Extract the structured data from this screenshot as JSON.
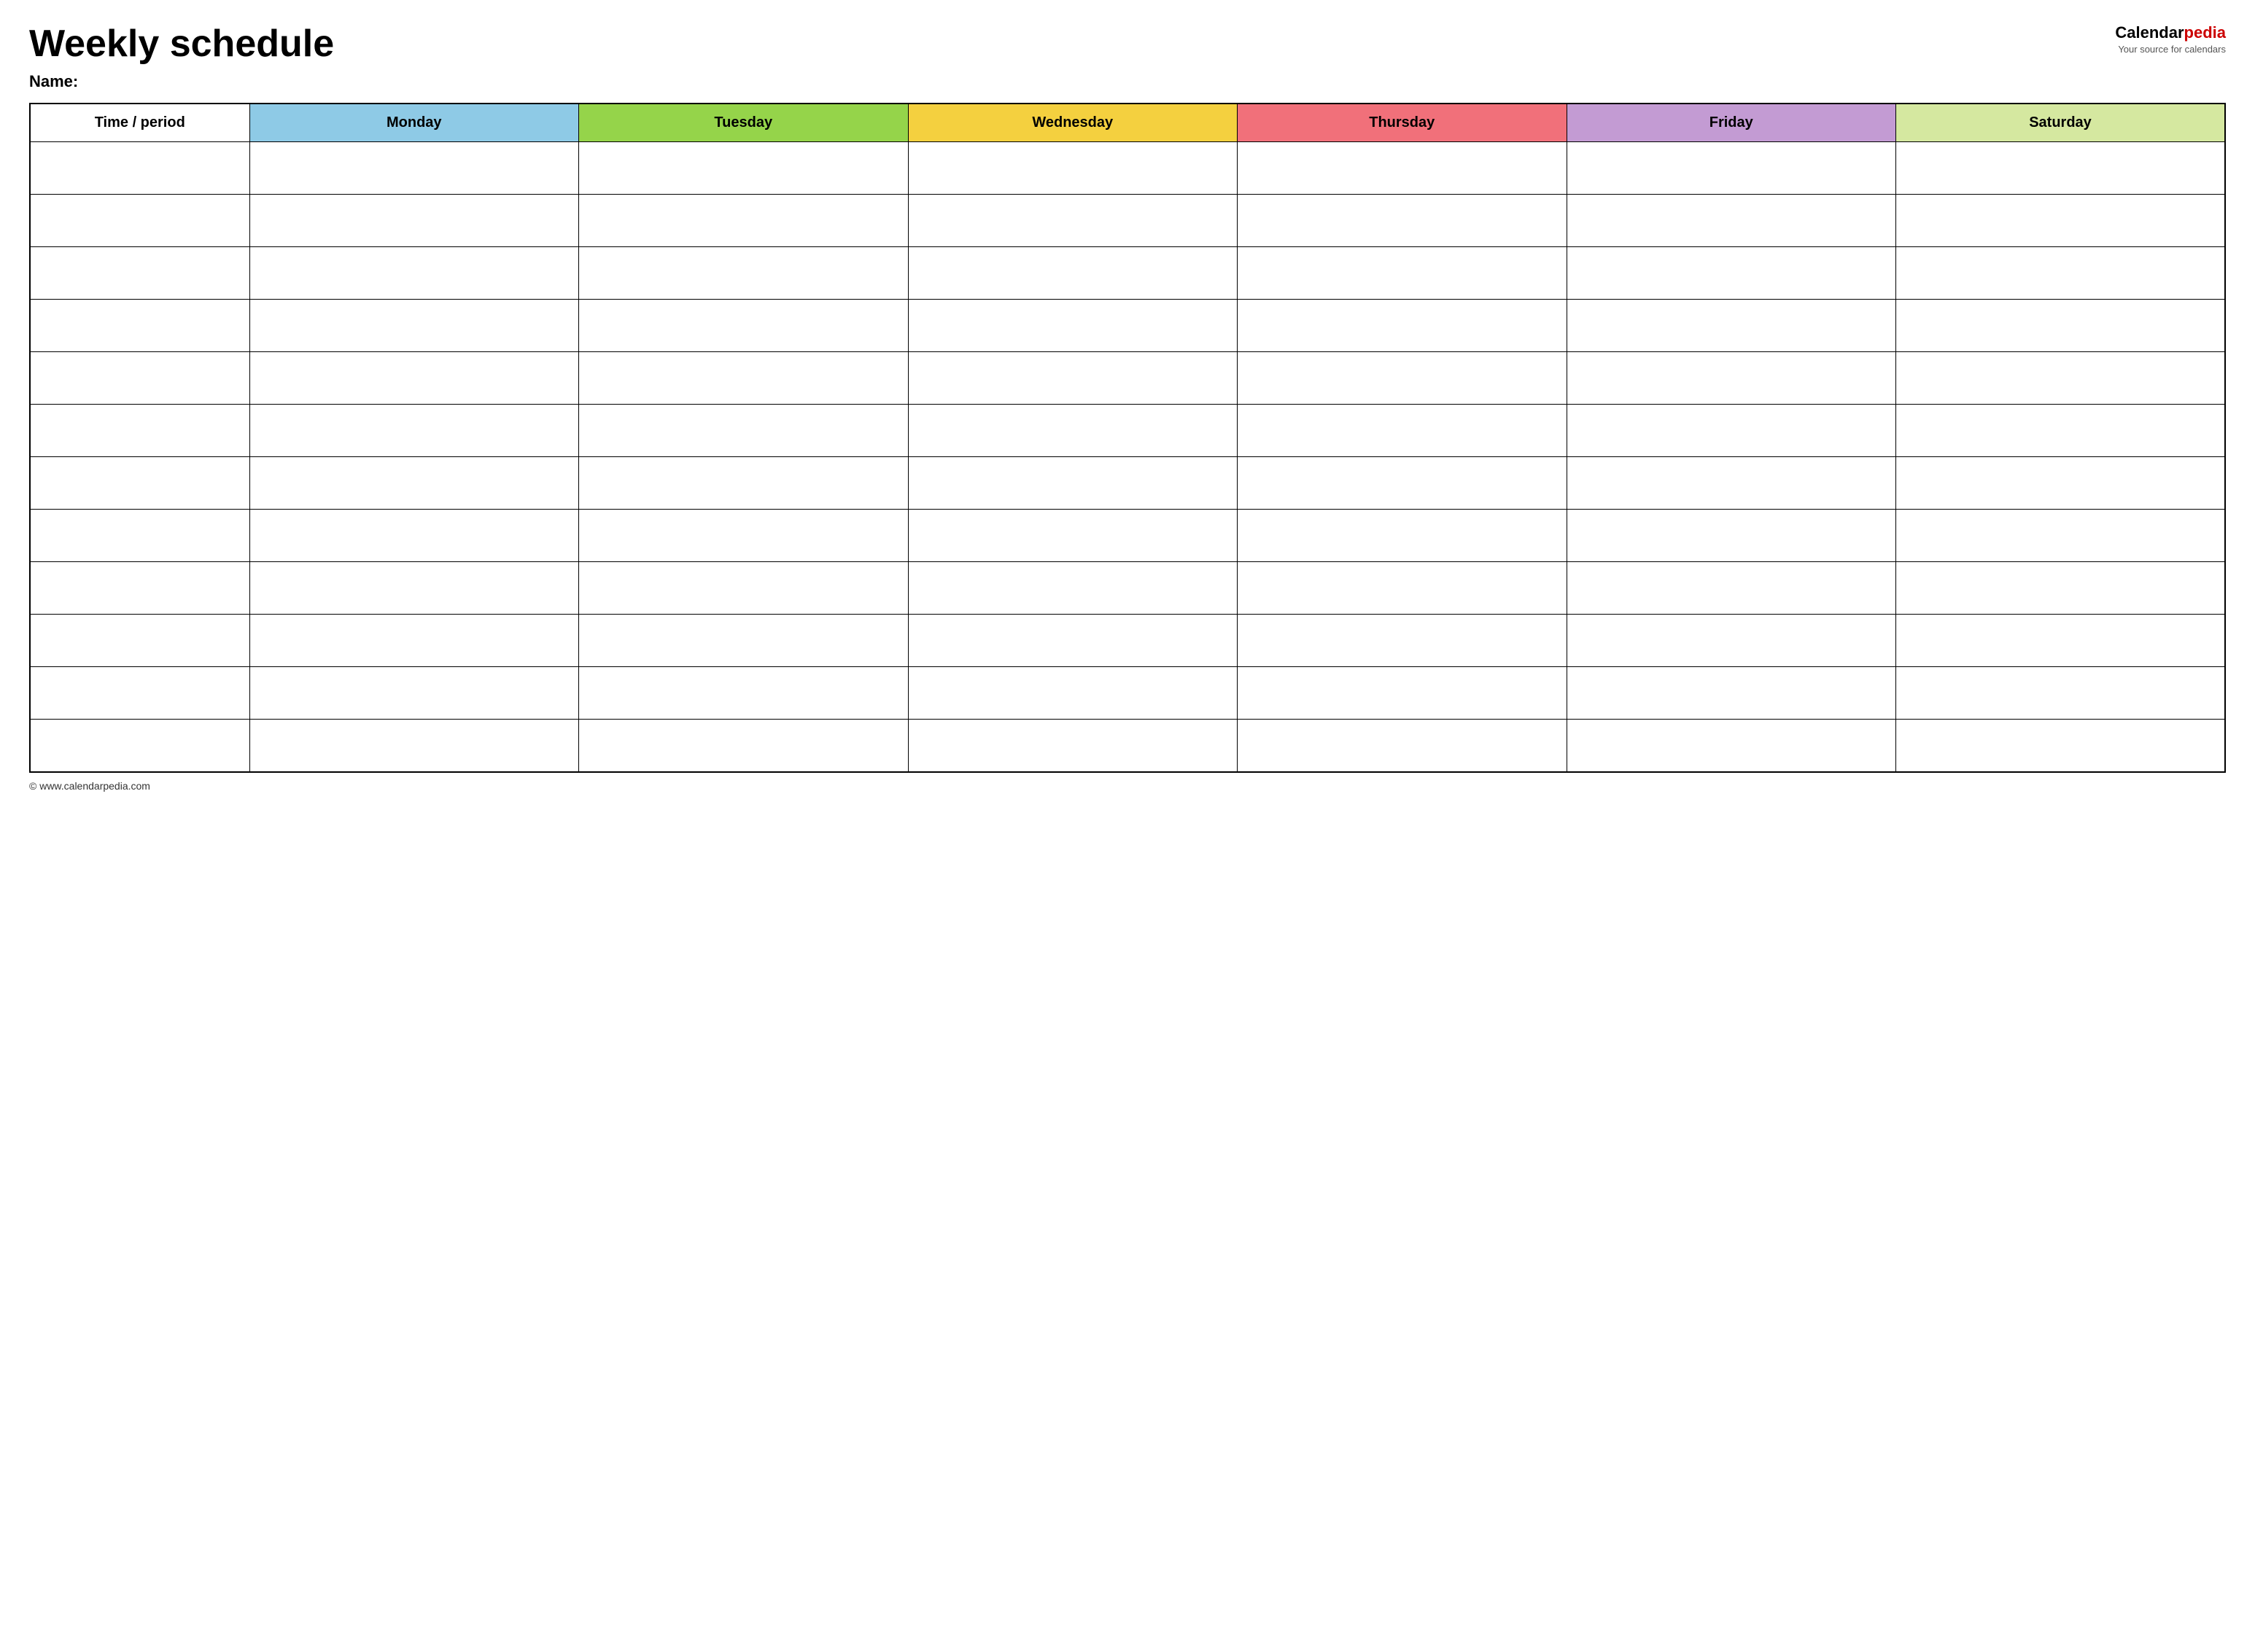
{
  "header": {
    "title": "Weekly schedule",
    "name_label": "Name:",
    "logo": {
      "calendar_part": "Calendar",
      "pedia_part": "pedia",
      "subtitle": "Your source for calendars"
    }
  },
  "table": {
    "columns": [
      {
        "key": "time",
        "label": "Time / period",
        "class": "th-time"
      },
      {
        "key": "monday",
        "label": "Monday",
        "class": "th-monday"
      },
      {
        "key": "tuesday",
        "label": "Tuesday",
        "class": "th-tuesday"
      },
      {
        "key": "wednesday",
        "label": "Wednesday",
        "class": "th-wednesday"
      },
      {
        "key": "thursday",
        "label": "Thursday",
        "class": "th-thursday"
      },
      {
        "key": "friday",
        "label": "Friday",
        "class": "th-friday"
      },
      {
        "key": "saturday",
        "label": "Saturday",
        "class": "th-saturday"
      }
    ],
    "rows": 12
  },
  "footer": {
    "url": "© www.calendarpedia.com"
  }
}
